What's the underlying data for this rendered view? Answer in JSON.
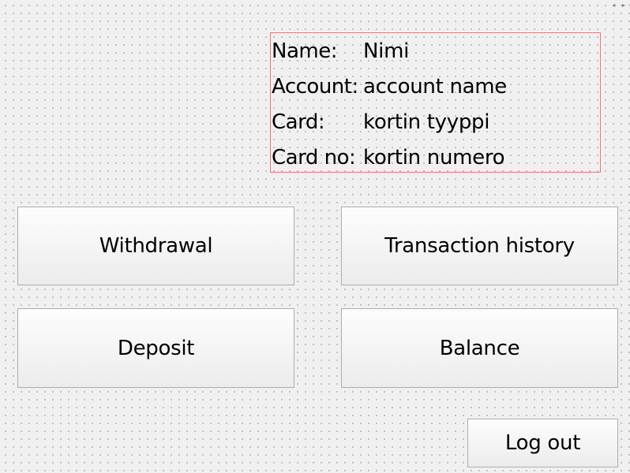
{
  "corner": {
    "arrows": "◂ ▸"
  },
  "account_info": {
    "name_label": "Name:",
    "name_value": "Nimi",
    "account_label": "Account:",
    "account_value": "account name",
    "card_label": "Card:",
    "card_value": "kortin tyyppi",
    "card_no_label": "Card no:",
    "card_no_value": "kortin numero"
  },
  "buttons": {
    "withdrawal": "Withdrawal",
    "transaction_history": "Transaction history",
    "deposit": "Deposit",
    "balance": "Balance",
    "log_out": "Log out"
  },
  "colors": {
    "info_border": "#e07a7a",
    "background": "#f0f0f0",
    "button_border": "#adadad"
  }
}
